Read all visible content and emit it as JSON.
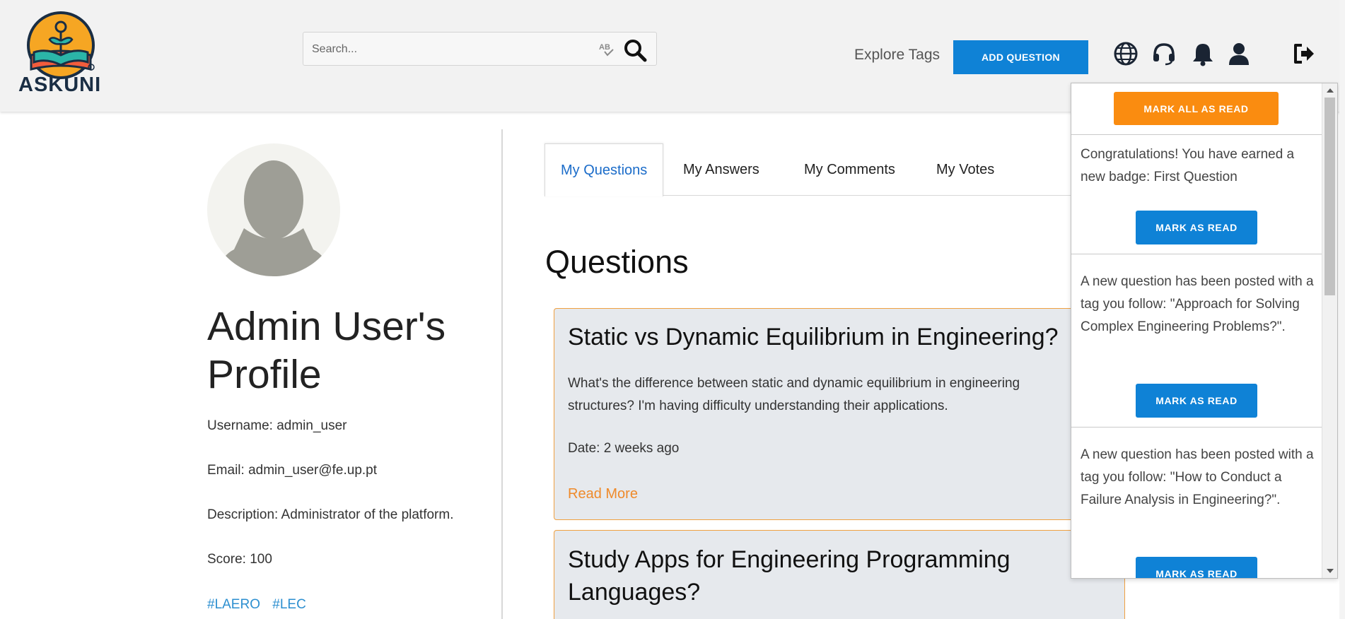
{
  "header": {
    "logo_text": "ASKUNI",
    "search_placeholder": "Search...",
    "explore_tags": "Explore Tags",
    "add_question": "ADD QUESTION",
    "icons": [
      "globe-icon",
      "headset-icon",
      "bell-icon",
      "user-icon",
      "logout-icon"
    ]
  },
  "profile": {
    "title": "Admin User's Profile",
    "username": "Username: admin_user",
    "email": "Email: admin_user@fe.up.pt",
    "description": "Description: Administrator of the platform.",
    "score": "Score: 100",
    "tags": [
      "#LAERO",
      "#LEC"
    ]
  },
  "tabs": [
    "My Questions",
    "My Answers",
    "My Comments",
    "My Votes"
  ],
  "active_tab": "My Questions",
  "section_title": "Questions",
  "questions": [
    {
      "title": "Static vs Dynamic Equilibrium in Engineering?",
      "body": "What's the difference between static and dynamic equilibrium in engineering structures? I'm having difficulty understanding their applications.",
      "date": "Date: 2 weeks ago",
      "read_more": "Read More"
    },
    {
      "title": "Study Apps for Engineering Programming Languages?"
    }
  ],
  "notifications": {
    "mark_all": "MARK ALL AS READ",
    "mark_read": "MARK AS READ",
    "items": [
      "Congratulations! You have earned a new badge: First Question",
      "A new question has been posted with a tag you follow: \"Approach for Solving Complex Engineering Problems?\".",
      "A new question has been posted with a tag you follow: \"How to Conduct a Failure Analysis in Engineering?\"."
    ]
  },
  "colors": {
    "primary": "#0f82d6",
    "accent_orange": "#fa8c10",
    "link_orange": "#ef8a2a",
    "tag_blue": "#2c8fd0",
    "card_bg": "#e6e9ed"
  }
}
